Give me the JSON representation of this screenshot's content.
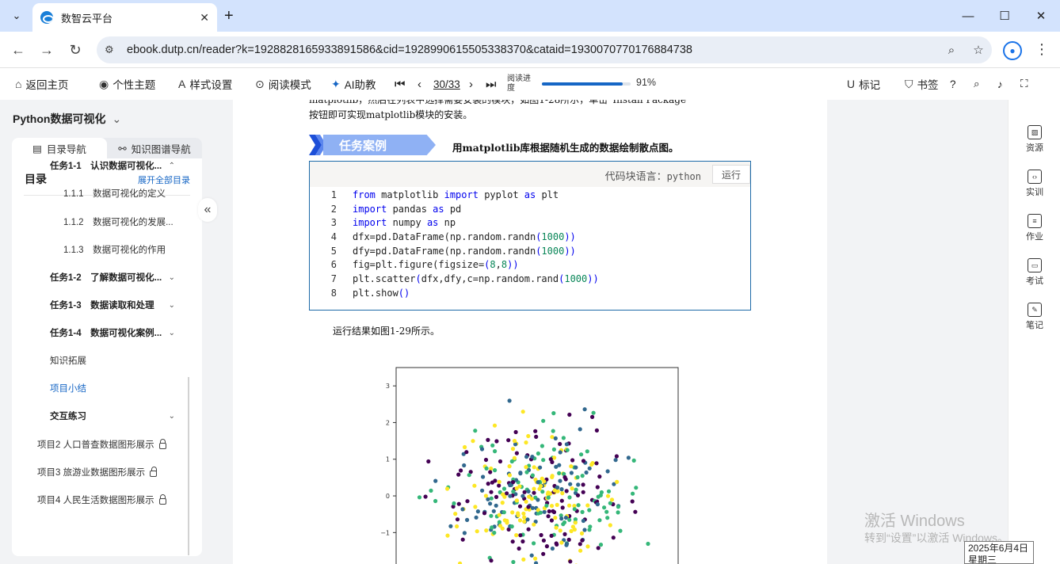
{
  "browser": {
    "tab_title": "数智云平台",
    "url": "ebook.dutp.cn/reader?k=1928828165933891586&cid=1928990615505338370&cataid=1930070770176884738"
  },
  "toolbar": {
    "back_home": "返回主页",
    "theme": "个性主题",
    "style": "样式设置",
    "read_mode": "阅读模式",
    "ai": "AI助教",
    "page_indicator": "30/33",
    "progress_label": "阅读进度",
    "progress_percent": "91%",
    "progress_value": 0.91,
    "marks": "标记",
    "bookmarks": "书签"
  },
  "sidebar": {
    "book_title": "Python数据可视化",
    "tab_toc": "目录导航",
    "tab_kg": "知识图谱导航",
    "toc_heading": "目录",
    "expand_all": "展开全部目录",
    "items": [
      {
        "label": "任务1-1　认识数据可视化...",
        "level": 1,
        "bold": true,
        "arrow": "⌃"
      },
      {
        "label": "1.1.1　数据可视化的定义",
        "level": 2
      },
      {
        "label": "1.1.2　数据可视化的发展...",
        "level": 2
      },
      {
        "label": "1.1.3　数据可视化的作用",
        "level": 2
      },
      {
        "label": "任务1-2　了解数据可视化...",
        "level": 1,
        "bold": true,
        "arrow": "⌄"
      },
      {
        "label": "任务1-3　数据读取和处理",
        "level": 1,
        "bold": true,
        "arrow": "⌄"
      },
      {
        "label": "任务1-4　数据可视化案例...",
        "level": 1,
        "bold": true,
        "arrow": "⌄"
      },
      {
        "label": "知识拓展",
        "level": 1
      },
      {
        "label": "项目小结",
        "level": 1,
        "selected": true
      },
      {
        "label": "交互练习",
        "level": 1,
        "bold": true,
        "arrow": "⌄"
      },
      {
        "label": "项目2 人口普查数据图形展示",
        "level": 0,
        "locked": true
      },
      {
        "label": "项目3 旅游业数据图形展示",
        "level": 0,
        "locked": true
      },
      {
        "label": "项目4 人民生活数据图形展示",
        "level": 0,
        "locked": true
      }
    ]
  },
  "content": {
    "cut_line": "matplotlib，然后在列表中选择需要安装的模块，如图1-28所示，单击“Install Package”",
    "para_line": "按钮即可实现matplotlib模块的安装。",
    "banner": "任务案例",
    "case_title": "用matplotlib库根据随机生成的数据绘制散点图。",
    "code_lang_label": "代码块语言：",
    "code_lang": "python",
    "run_button": "运行",
    "code": [
      {
        "n": "1",
        "parts": [
          [
            "kw",
            "from"
          ],
          [
            "t",
            " matplotlib "
          ],
          [
            "kw",
            "import"
          ],
          [
            "t",
            " pyplot "
          ],
          [
            "kw",
            "as"
          ],
          [
            "t",
            " plt"
          ]
        ]
      },
      {
        "n": "2",
        "parts": [
          [
            "kw",
            "import"
          ],
          [
            "t",
            " pandas "
          ],
          [
            "kw",
            "as"
          ],
          [
            "t",
            " pd"
          ]
        ]
      },
      {
        "n": "3",
        "parts": [
          [
            "kw",
            "import"
          ],
          [
            "t",
            " numpy "
          ],
          [
            "kw",
            "as"
          ],
          [
            "t",
            " np"
          ]
        ]
      },
      {
        "n": "4",
        "parts": [
          [
            "t",
            "dfx=pd.DataFrame(np.random.randn"
          ],
          [
            "kw",
            "("
          ],
          [
            "num",
            "1000"
          ],
          [
            "kw",
            "))"
          ]
        ]
      },
      {
        "n": "5",
        "parts": [
          [
            "t",
            "dfy=pd.DataFrame(np.random.randn"
          ],
          [
            "kw",
            "("
          ],
          [
            "num",
            "1000"
          ],
          [
            "kw",
            "))"
          ]
        ]
      },
      {
        "n": "6",
        "parts": [
          [
            "t",
            "fig=plt.figure(figsize="
          ],
          [
            "kw",
            "("
          ],
          [
            "num",
            "8"
          ],
          [
            "t",
            ","
          ],
          [
            "num",
            "8"
          ],
          [
            "kw",
            "))"
          ]
        ]
      },
      {
        "n": "7",
        "parts": [
          [
            "t",
            "plt.scatter"
          ],
          [
            "kw",
            "("
          ],
          [
            "t",
            "dfx,dfy,c=np.random.rand"
          ],
          [
            "kw",
            "("
          ],
          [
            "num",
            "1000"
          ],
          [
            "kw",
            "))"
          ]
        ]
      },
      {
        "n": "8",
        "parts": [
          [
            "t",
            "plt.show"
          ],
          [
            "kw",
            "()"
          ]
        ]
      }
    ],
    "result_text": "运行结果如图1-29所示。"
  },
  "chart_data": {
    "type": "scatter",
    "title": "",
    "xlabel": "",
    "ylabel": "",
    "yticks": [
      "3",
      "2",
      "1",
      "0",
      "−1"
    ],
    "ylim": [
      -1.9,
      3.5
    ],
    "xlim": [
      -3.2,
      3.2
    ],
    "n_points_visible": 420,
    "colormap": [
      "#440154",
      "#31688e",
      "#35b779",
      "#fde725"
    ]
  },
  "right_rail": [
    {
      "label": "资源",
      "icon": "image-icon"
    },
    {
      "label": "实训",
      "icon": "code-icon"
    },
    {
      "label": "作业",
      "icon": "homework-icon"
    },
    {
      "label": "考试",
      "icon": "exam-icon"
    },
    {
      "label": "笔记",
      "icon": "notes-icon"
    }
  ],
  "overlay": {
    "activate_title": "激活 Windows",
    "activate_sub": "转到“设置”以激活 Windows。",
    "date": "2025年6月4日",
    "weekday": "星期三"
  }
}
